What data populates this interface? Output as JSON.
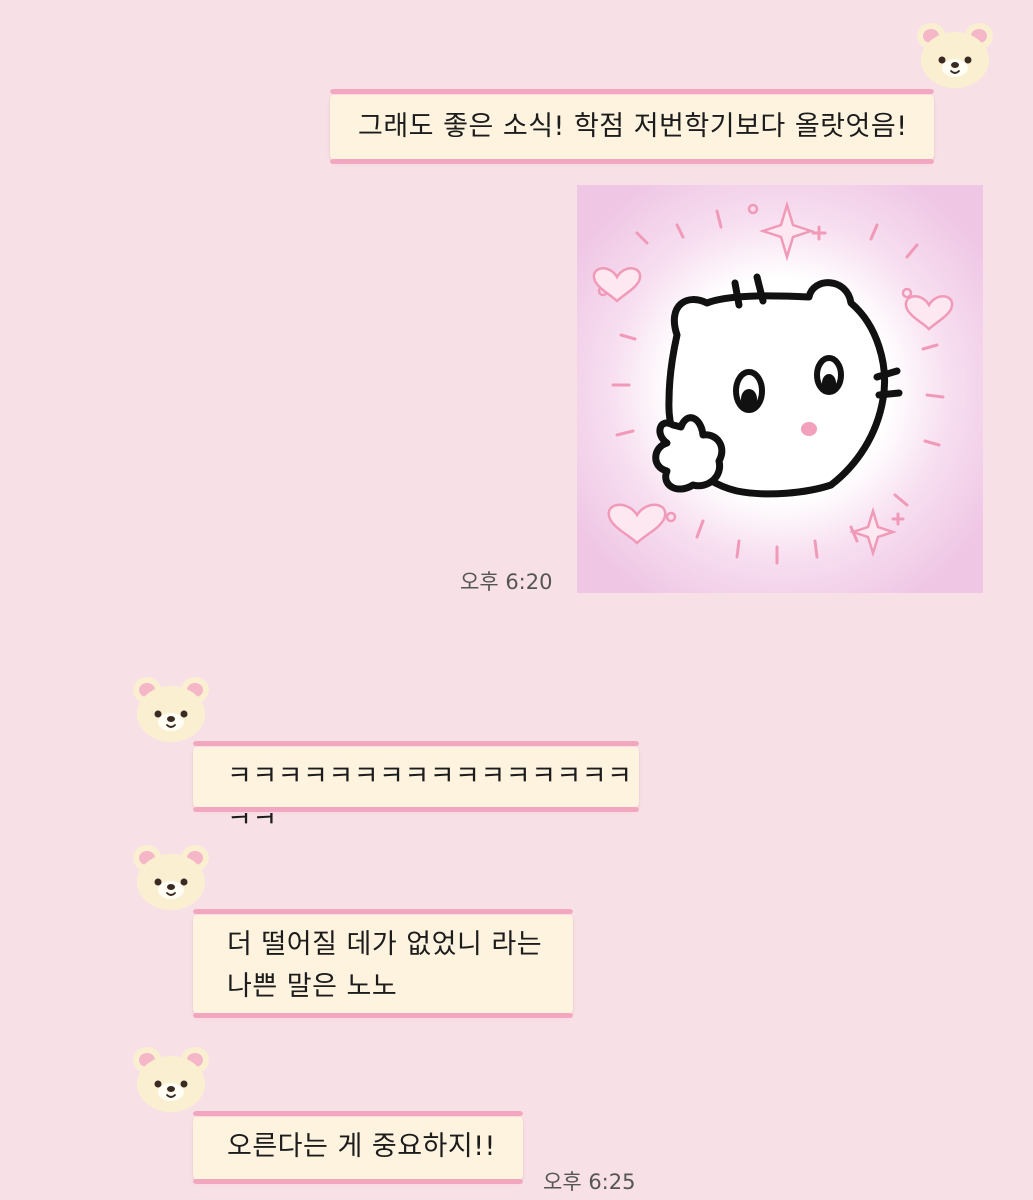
{
  "conversation": {
    "messages": [
      {
        "sender": "me",
        "text": "그래도 좋은 소식! 학점 저번학기보다 올랏엇음!"
      },
      {
        "sender": "me",
        "type": "sticker",
        "sticker_name": "bear-peace-sign-sticker",
        "time": "오후 6:20"
      },
      {
        "sender": "other",
        "text": "ㅋㅋㅋㅋㅋㅋㅋㅋㅋㅋㅋㅋㅋㅋㅋㅋㅋㅋ"
      },
      {
        "sender": "other",
        "text": "더 떨어질 데가 없었니 라는\n나쁜 말은 노노"
      },
      {
        "sender": "other",
        "text": "오른다는 게 중요하지!!",
        "time": "오후 6:25"
      }
    ]
  },
  "avatar_icon": "bear-face-icon",
  "theme": {
    "background": "#f7e1e6",
    "bubble_fill": "#fdf3df",
    "bubble_border": "#f3a6c0",
    "sticker_background": "#f2cbe6"
  }
}
